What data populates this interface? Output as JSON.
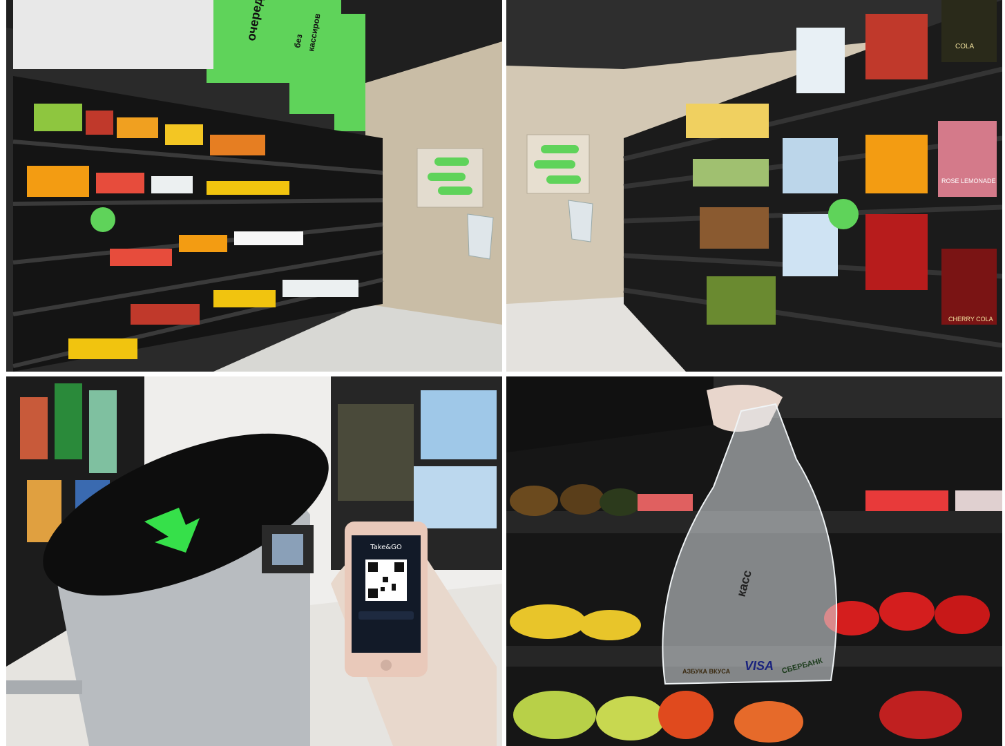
{
  "collage": {
    "panels": [
      {
        "id": "top-left",
        "subject": "green-store-refrigerator-aisle",
        "sign_texts": [
          "очередей",
          "без",
          "касс",
          "кассиров",
          "без"
        ],
        "colors": {
          "accent": "#5fd35a",
          "wall": "#cbbfa8",
          "shelf": "#1c1c1c"
        }
      },
      {
        "id": "top-right",
        "subject": "beverage-shelves-aisle",
        "bottle_labels": [
          "COLA",
          "ROSE LEMONADE",
          "CHERRY COLA"
        ],
        "colors": {
          "accent": "#5fd35a",
          "wall": "#d3c8b4",
          "shelf": "#202020"
        }
      },
      {
        "id": "bottom-left",
        "subject": "turnstile-with-phone-qr",
        "phone": {
          "app_title": "Take&GO"
        },
        "colors": {
          "arrow": "#36e04a",
          "steel": "#b8bcc0"
        }
      },
      {
        "id": "bottom-right",
        "subject": "hand-holding-plastic-bag",
        "bag_texts": [
          "касс",
          "VISA",
          "АЗБУКА ВКУСА",
          "СБЕРБАНК"
        ],
        "colors": {
          "shelf": "#1a1a1a",
          "produce": "#e8c52a"
        }
      }
    ]
  }
}
